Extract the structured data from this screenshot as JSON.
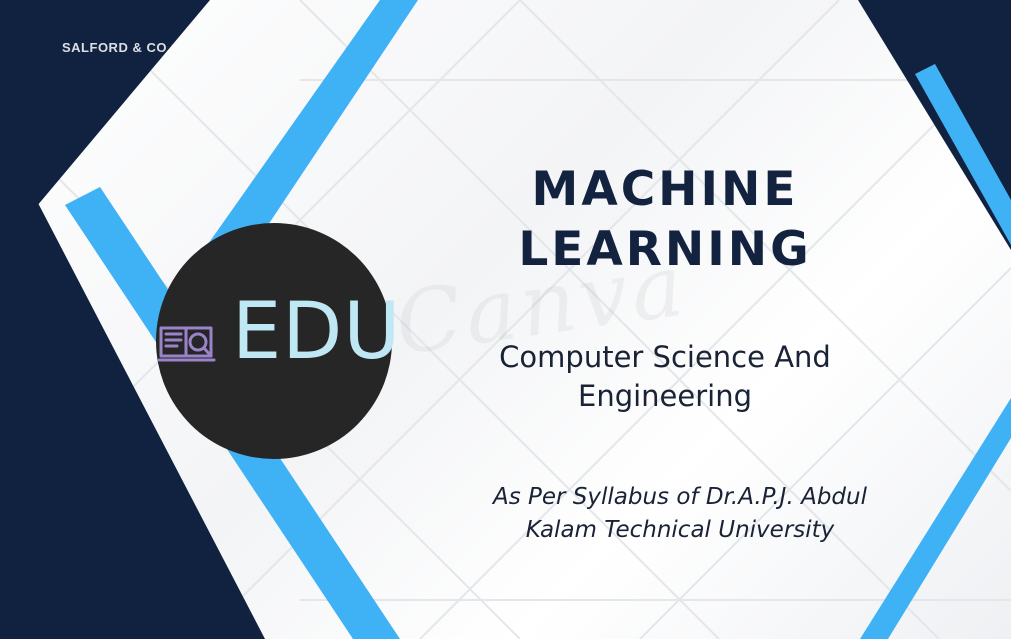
{
  "watermark_top": "SALFORD & CO.",
  "watermark_center": "Canva",
  "logo": {
    "text": "EDU",
    "icon": "book-magnifier-icon"
  },
  "title_lines": [
    "MACHINE",
    "LEARNING"
  ],
  "subtitle_lines": [
    "Computer Science And",
    "Engineering"
  ],
  "tagline_lines": [
    "As Per Syllabus of Dr.A.P.J. Abdul",
    "Kalam Technical University"
  ],
  "colors": {
    "navy": "#10223f",
    "sky_blue": "#3fb1f5",
    "logo_bg": "#262626",
    "logo_text": "#bfe8f4",
    "book_icon": "#9a83c9",
    "heading": "#12223f"
  }
}
